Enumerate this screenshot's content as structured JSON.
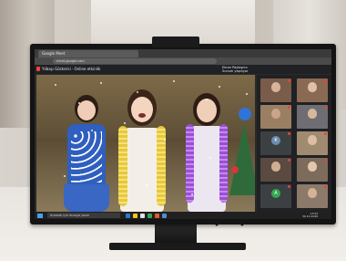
{
  "scene": {
    "description_hidden": ""
  },
  "browser": {
    "tab_title": "Google Meet",
    "url_text": "meet.google.com"
  },
  "meet": {
    "meeting_title": "Yılbaşı Gösterisi · Online etkinlik",
    "user_line1": "Ekran Paylaşımı",
    "user_line2": "Sunum yapılıyor"
  },
  "participants": [
    {
      "label": "",
      "kind": "photo",
      "face": "#d7b39a",
      "bg": "#7a5c4a"
    },
    {
      "label": "",
      "kind": "photo",
      "face": "#e0c0a8",
      "bg": "#8a6a52"
    },
    {
      "label": "",
      "kind": "photo",
      "face": "#caa58a",
      "bg": "#9a7f63"
    },
    {
      "label": "",
      "kind": "photo",
      "face": "#d9b79a",
      "bg": "#6e6e72"
    },
    {
      "label": "",
      "kind": "letter",
      "letter": "K",
      "color": "#6a8caf"
    },
    {
      "label": "",
      "kind": "photo",
      "face": "#dcbfa2",
      "bg": "#a08a70"
    },
    {
      "label": "",
      "kind": "photo",
      "face": "#cfae92",
      "bg": "#5a4a40"
    },
    {
      "label": "",
      "kind": "photo",
      "face": "#e3c7ad",
      "bg": "#7d6b5c"
    },
    {
      "label": "",
      "kind": "letter",
      "letter": "A",
      "color": "#33a852"
    },
    {
      "label": "",
      "kind": "photo",
      "face": "#d4b197",
      "bg": "#8b7a6a"
    }
  ],
  "taskbar": {
    "search_placeholder": "Aramak için buraya yazın",
    "time": "13:54",
    "date": "30.12.2020"
  },
  "colors": {
    "meet_red": "#ea4335",
    "meet_green": "#34a853",
    "dress_blue": "#2f5fbf",
    "tinsel_gold": "#e8c83a",
    "tinsel_purple": "#9b4fd6"
  }
}
